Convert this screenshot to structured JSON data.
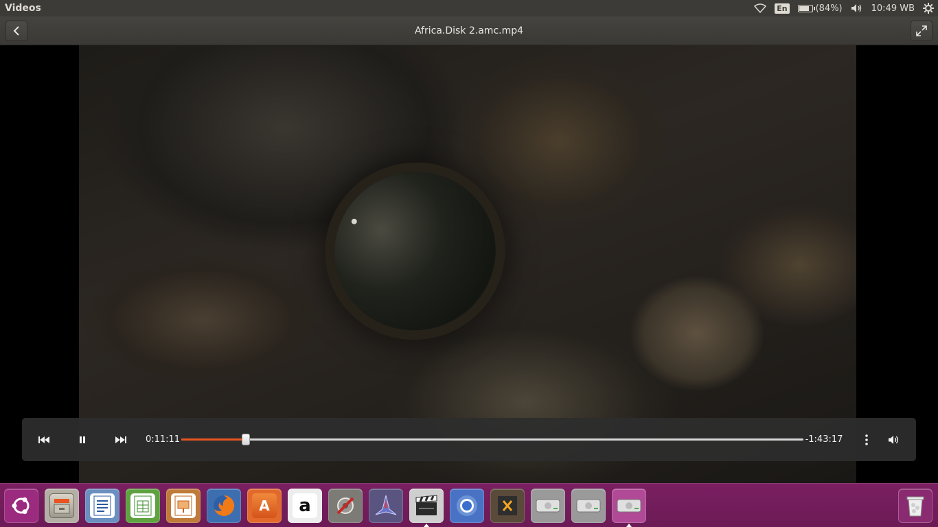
{
  "top_panel": {
    "app_name": "Videos",
    "keyboard_layout": "En",
    "battery_percent_text": "(84%)",
    "battery_level": 0.84,
    "clock": "10:49 WB",
    "icons": [
      "wifi-icon",
      "battery-icon",
      "volume-icon",
      "settings-gear-icon"
    ]
  },
  "title_bar": {
    "title": "Africa.Disk 2.amc.mp4",
    "back_icon": "chevron-left-icon",
    "fullscreen_icon": "fullscreen-icon"
  },
  "player": {
    "elapsed": "0:11:11",
    "remaining": "-1:43:17",
    "progress": 0.104,
    "controls": [
      "previous-track-icon",
      "pause-icon",
      "next-track-icon",
      "more-menu-icon",
      "volume-icon"
    ],
    "accent_color": "#e95420"
  },
  "launcher": {
    "background_color": "#6c1b56",
    "items": [
      {
        "name": "ubuntu-dash",
        "icon": "ubuntu-logo-icon"
      },
      {
        "name": "files",
        "icon": "file-cabinet-icon"
      },
      {
        "name": "writer",
        "icon": "document-icon"
      },
      {
        "name": "calc",
        "icon": "spreadsheet-icon"
      },
      {
        "name": "impress",
        "icon": "presentation-icon"
      },
      {
        "name": "firefox",
        "icon": "firefox-icon"
      },
      {
        "name": "software-center",
        "icon": "shopping-bag-icon",
        "glyph": "A"
      },
      {
        "name": "amazon",
        "icon": "amazon-icon",
        "glyph": "a"
      },
      {
        "name": "system-settings",
        "icon": "wrench-gear-icon"
      },
      {
        "name": "game-app",
        "icon": "spaceship-icon"
      },
      {
        "name": "videos",
        "icon": "clapperboard-icon",
        "active": true
      },
      {
        "name": "chromium",
        "icon": "chromium-icon"
      },
      {
        "name": "code-editor",
        "icon": "code-editor-icon"
      },
      {
        "name": "drive-1",
        "icon": "hard-drive-icon"
      },
      {
        "name": "drive-2",
        "icon": "hard-drive-icon"
      },
      {
        "name": "drive-3",
        "icon": "hard-drive-icon"
      },
      {
        "name": "trash",
        "icon": "trash-icon"
      }
    ]
  }
}
